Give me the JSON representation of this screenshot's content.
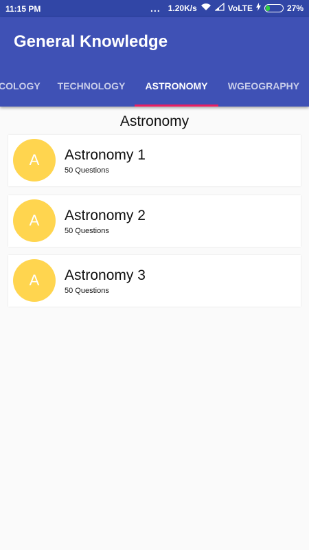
{
  "status": {
    "time": "11:15 PM",
    "dots": "...",
    "speed": "1.20K/s",
    "network": "VoLTE",
    "battery": "27%",
    "battery_level": 0.27
  },
  "app": {
    "title": "General Knowledge"
  },
  "tabs": [
    {
      "label": "COLOGY"
    },
    {
      "label": "TECHNOLOGY"
    },
    {
      "label": "ASTRONOMY"
    },
    {
      "label": "WGEOGRAPHY"
    }
  ],
  "page": {
    "title": "Astronomy"
  },
  "items": [
    {
      "letter": "A",
      "title": "Astronomy 1",
      "subtitle": "50 Questions"
    },
    {
      "letter": "A",
      "title": "Astronomy 2",
      "subtitle": "50 Questions"
    },
    {
      "letter": "A",
      "title": "Astronomy 3",
      "subtitle": "50 Questions"
    }
  ],
  "colors": {
    "appbar": "#3f51b5",
    "statusbar": "#3146a6",
    "indicator": "#e91e63",
    "avatar": "#ffd54f"
  }
}
